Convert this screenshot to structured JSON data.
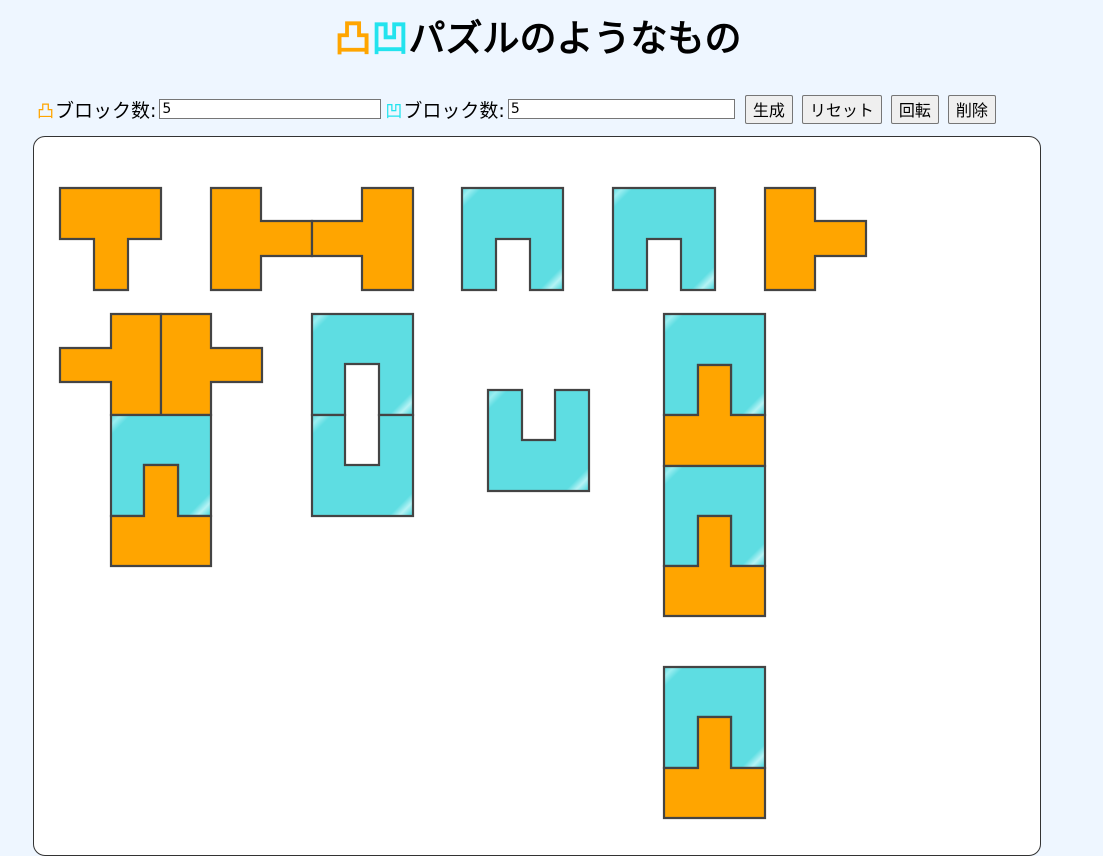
{
  "header": {
    "icon_convex": "凸",
    "icon_concave": "凹",
    "title": "パズルのようなもの"
  },
  "toolbar": {
    "convex_label": "ブロック数:",
    "convex_value": "5",
    "concave_label": "ブロック数:",
    "concave_value": "5",
    "generate_label": "生成",
    "reset_label": "リセット",
    "rotate_label": "回転",
    "delete_label": "削除"
  },
  "colors": {
    "convex": "#ffa500",
    "concave": "#5edde2",
    "outline": "#444444",
    "background": "#eef6ff"
  },
  "icons": {
    "convex": "convex-block-icon",
    "concave": "concave-block-icon"
  }
}
